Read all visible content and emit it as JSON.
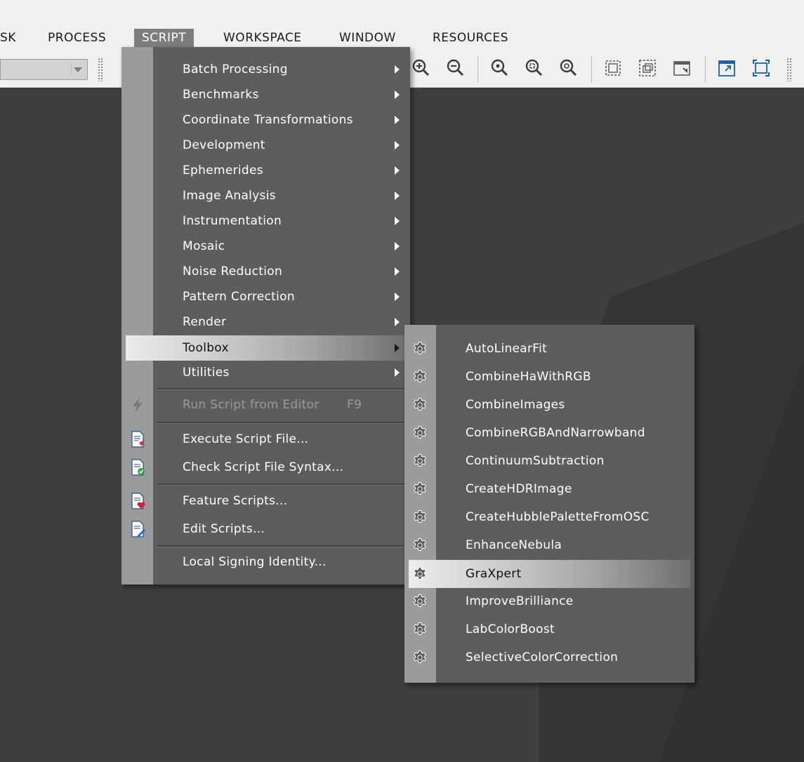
{
  "menubar": {
    "items": [
      {
        "label": "SK"
      },
      {
        "label": "PROCESS"
      },
      {
        "label": "SCRIPT"
      },
      {
        "label": "WORKSPACE"
      },
      {
        "label": "WINDOW"
      },
      {
        "label": "RESOURCES"
      }
    ],
    "active": "SCRIPT"
  },
  "toolbar": {
    "combo_value": "",
    "buttons": [
      "zoom-in-icon",
      "zoom-out-icon",
      "zoom-1-1-icon",
      "fit-view-icon",
      "zoom-to-fit-icon",
      "select-region-icon",
      "select-region-all-icon",
      "window-shrink-icon",
      "window-maximize-icon",
      "fullscreen-icon"
    ]
  },
  "script_menu": {
    "items": [
      {
        "label": "Batch Processing",
        "submenu": true
      },
      {
        "label": "Benchmarks",
        "submenu": true
      },
      {
        "label": "Coordinate Transformations",
        "submenu": true
      },
      {
        "label": "Development",
        "submenu": true
      },
      {
        "label": "Ephemerides",
        "submenu": true
      },
      {
        "label": "Image Analysis",
        "submenu": true
      },
      {
        "label": "Instrumentation",
        "submenu": true
      },
      {
        "label": "Mosaic",
        "submenu": true
      },
      {
        "label": "Noise Reduction",
        "submenu": true
      },
      {
        "label": "Pattern Correction",
        "submenu": true
      },
      {
        "label": "Render",
        "submenu": true
      },
      {
        "label": "Toolbox",
        "submenu": true,
        "highlighted": true
      },
      {
        "label": "Utilities",
        "submenu": true
      }
    ],
    "run_script": {
      "label": "Run Script from Editor",
      "shortcut": "F9",
      "icon": "lightning-icon",
      "disabled": true
    },
    "execute_script": {
      "label": "Execute Script File...",
      "icon": "script-run-icon"
    },
    "check_syntax": {
      "label": "Check Script File Syntax...",
      "icon": "script-check-icon"
    },
    "feature_scripts": {
      "label": "Feature Scripts...",
      "icon": "script-favorite-icon"
    },
    "edit_scripts": {
      "label": "Edit Scripts...",
      "icon": "script-edit-icon"
    },
    "signing_identity": {
      "label": "Local Signing Identity..."
    }
  },
  "toolbox_submenu": {
    "items": [
      {
        "label": "AutoLinearFit"
      },
      {
        "label": "CombineHaWithRGB"
      },
      {
        "label": "CombineImages"
      },
      {
        "label": "CombineRGBAndNarrowband"
      },
      {
        "label": "ContinuumSubtraction"
      },
      {
        "label": "CreateHDRImage"
      },
      {
        "label": "CreateHubblePaletteFromOSC"
      },
      {
        "label": "EnhanceNebula"
      },
      {
        "label": "GraXpert",
        "highlighted": true
      },
      {
        "label": "ImproveBrilliance"
      },
      {
        "label": "LabColorBoost"
      },
      {
        "label": "SelectiveColorCorrection"
      }
    ],
    "item_icon": "gear-icon"
  }
}
